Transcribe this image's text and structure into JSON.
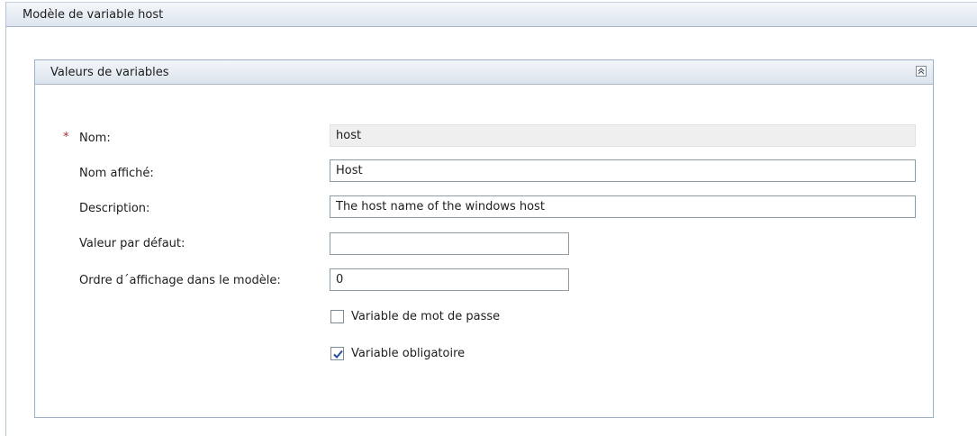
{
  "outer": {
    "title": "Modèle de variable host"
  },
  "panel": {
    "title": "Valeurs de variables",
    "collapse_icon": "chevron-double-up-icon"
  },
  "form": {
    "required_marker": "*",
    "name": {
      "label": "Nom:",
      "value": "host",
      "readonly": true,
      "required": true
    },
    "display_name": {
      "label": "Nom affiché:",
      "value": "Host"
    },
    "description": {
      "label": "Description:",
      "value": "The host name of the windows host"
    },
    "default_value": {
      "label": "Valeur par défaut:",
      "value": ""
    },
    "display_order": {
      "label": "Ordre d´affichage dans le modèle:",
      "value": "0"
    },
    "password_variable": {
      "label": "Variable de mot de passe",
      "checked": false
    },
    "mandatory_variable": {
      "label": "Variable obligatoire",
      "checked": true
    }
  },
  "colors": {
    "required_star": "#d02020",
    "check_mark": "#1f4fa3"
  }
}
